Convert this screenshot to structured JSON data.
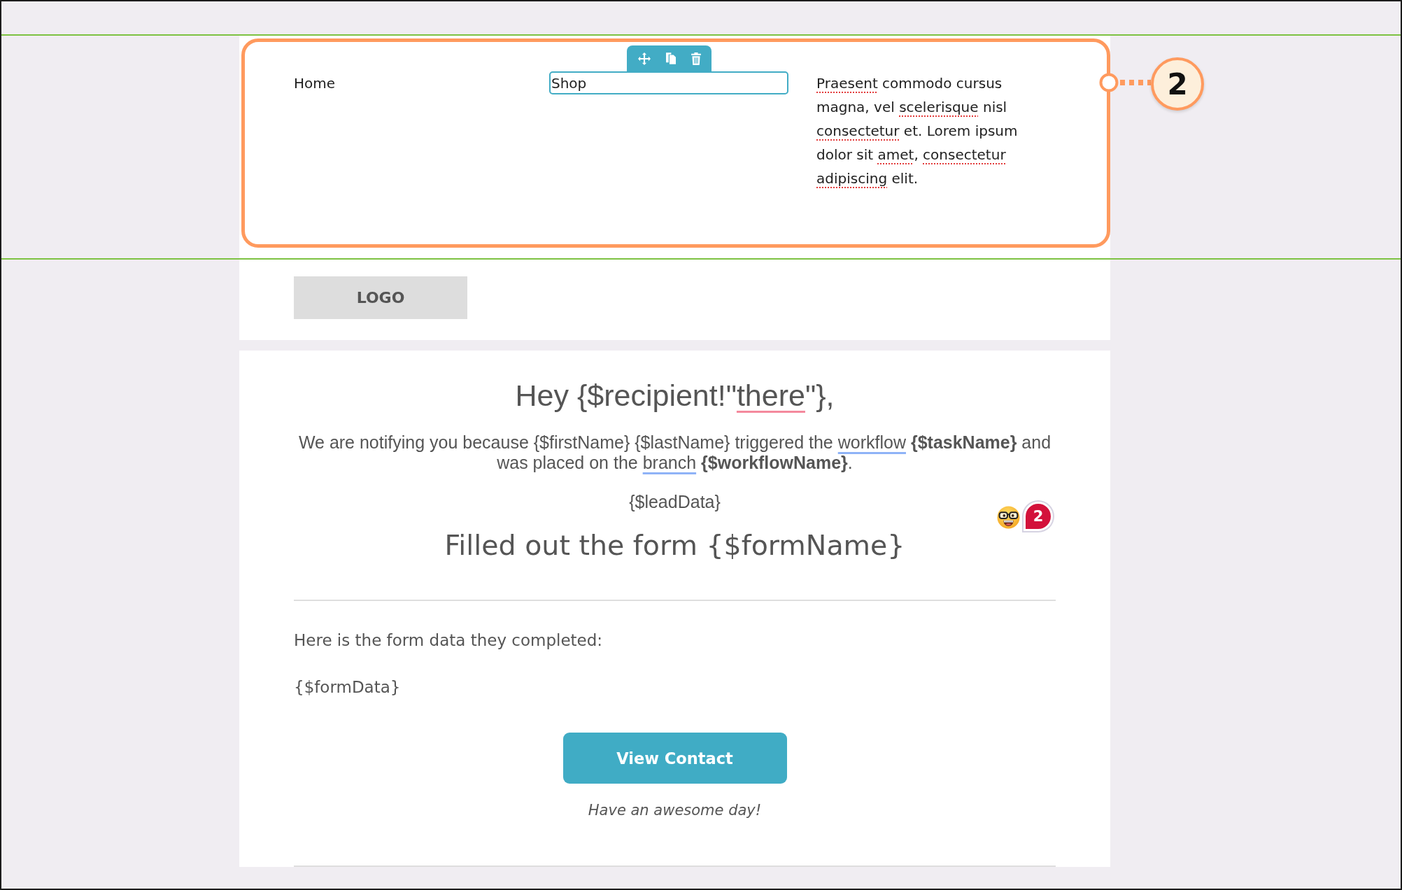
{
  "selected_block": {
    "selected": true,
    "columns": [
      {
        "kind": "text",
        "text": "Home"
      },
      {
        "kind": "input",
        "value": "Shop",
        "focused": true
      },
      {
        "kind": "paragraph",
        "segments": [
          {
            "text": "Praesent",
            "misspelled": true
          },
          {
            "text": " commodo cursus magna, vel ",
            "misspelled": false
          },
          {
            "text": "scelerisque",
            "misspelled": true
          },
          {
            "text": " nisl ",
            "misspelled": false
          },
          {
            "text": "consectetur",
            "misspelled": true
          },
          {
            "text": " et. Lorem ipsum dolor sit ",
            "misspelled": false
          },
          {
            "text": "amet",
            "misspelled": true
          },
          {
            "text": ", ",
            "misspelled": false
          },
          {
            "text": "consectetur ",
            "misspelled": true
          },
          {
            "text": "adipiscing",
            "misspelled": true
          },
          {
            "text": " elit.",
            "misspelled": false
          }
        ]
      }
    ]
  },
  "callout": {
    "number": "2"
  },
  "logo_section": {
    "selected": false,
    "logo": "LOGO"
  },
  "email_body": {
    "greeting": [
      {
        "text": "Hey {$recipient!\"",
        "misspelled": false
      },
      {
        "text": "there",
        "misspelled": true
      },
      {
        "text": "\"},",
        "misspelled": false
      }
    ],
    "intro": [
      {
        "text": "We are notifying you because {$firstName} {$lastName} triggered the ",
        "suggestion": false
      },
      {
        "text": "workflow",
        "suggestion": true
      },
      {
        "text": " **{$taskName}** and was placed on the ",
        "suggestion": false
      },
      {
        "text": "branch",
        "suggestion": true
      },
      {
        "text": " **{$workflowName}**.",
        "suggestion": false
      }
    ],
    "lead_data": "{$leadData}",
    "comment_marker": {
      "count": "2"
    },
    "form_heading": "Filled out the form {$formName}",
    "form_intro": "Here is the form data they completed:",
    "form_data": "{$formData}",
    "button": "View Contact",
    "closing": "Have an awesome day!"
  }
}
